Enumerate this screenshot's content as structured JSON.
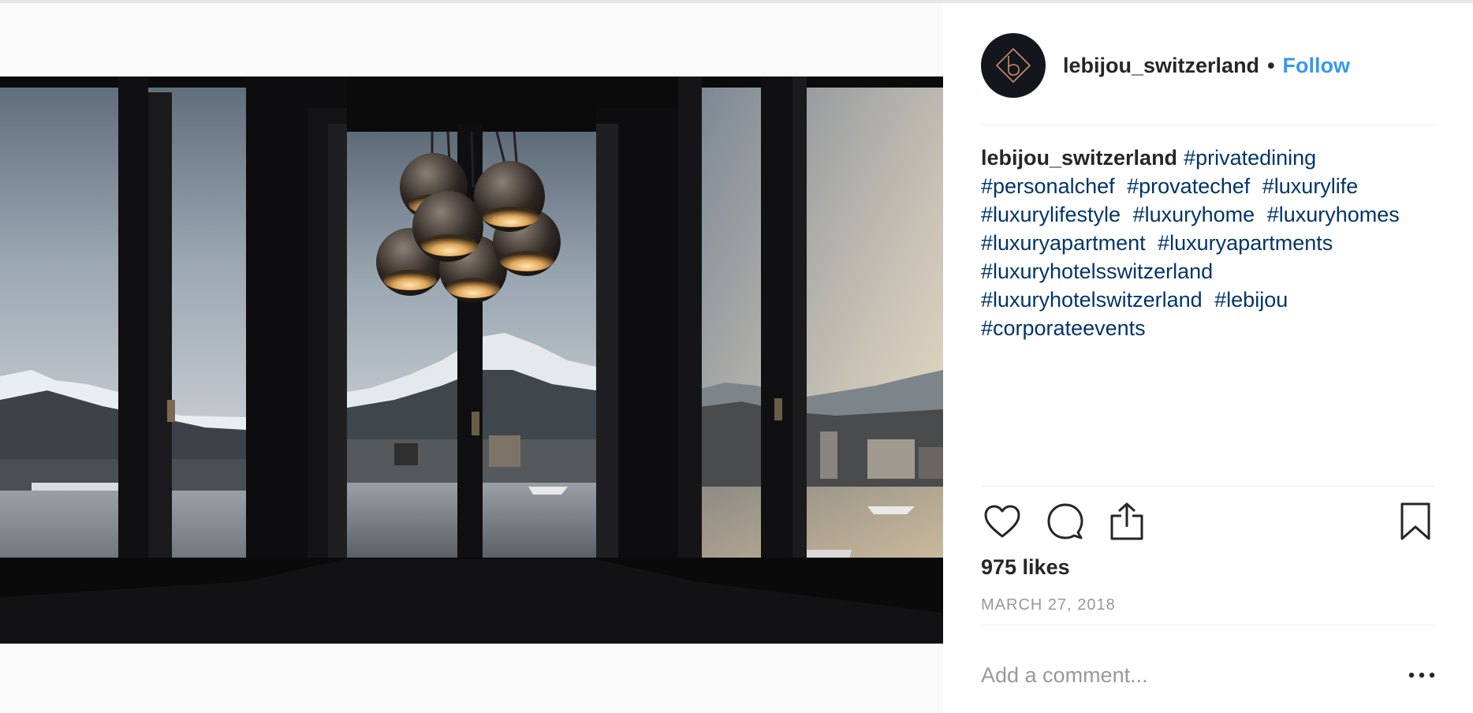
{
  "post": {
    "username": "lebijou_switzerland",
    "separator": "•",
    "follow_label": "Follow",
    "caption": {
      "username": "lebijou_switzerland",
      "hashtags": [
        "#privatedining",
        "#personalchef",
        "#provatechef",
        "#luxurylife",
        "#luxurylifestyle",
        "#luxuryhome",
        "#luxuryhomes",
        "#luxuryapartment",
        "#luxuryapartments",
        "#luxuryhotelsswitzerland",
        "#luxuryhotelswitzerland",
        "#lebijou",
        "#corporateevents"
      ]
    },
    "likes": "975 likes",
    "date": "MARCH 27, 2018",
    "comment_placeholder": "Add a comment..."
  },
  "icons": {
    "like": "heart-icon",
    "comment": "comment-bubble-icon",
    "share": "share-icon",
    "save": "bookmark-icon",
    "more": "more-options-icon",
    "avatar": "lebijou-logo"
  },
  "colors": {
    "follow": "#3897f0",
    "hashtag": "#003569",
    "text": "#262626",
    "muted": "#999999",
    "avatar_bg": "#14161d",
    "logo_stroke": "#c98e6a"
  }
}
